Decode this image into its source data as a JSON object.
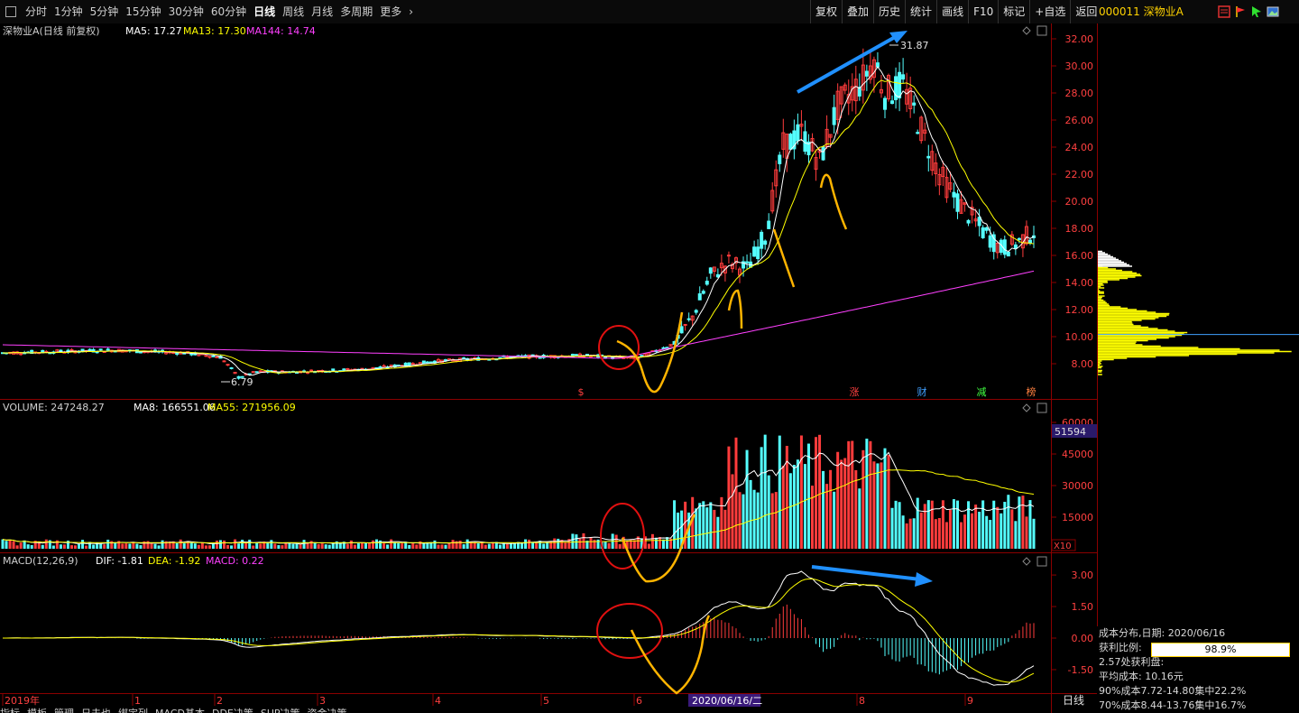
{
  "toolbar": {
    "menu_icon": "window-icon",
    "periods": [
      "分时",
      "1分钟",
      "5分钟",
      "15分钟",
      "30分钟",
      "60分钟",
      "日线",
      "周线",
      "月线",
      "多周期",
      "更多"
    ],
    "active_period": "日线",
    "more_chevron": "›",
    "buttons": [
      "复权",
      "叠加",
      "历史",
      "统计",
      "画线",
      "F10",
      "标记",
      "+自选",
      "返回"
    ],
    "stock_code": "000011",
    "stock_name": "深物业A"
  },
  "main_panel": {
    "title": "深物业A(日线 前复权)",
    "ma5": "MA5: 17.27",
    "ma13": "MA13: 17.30",
    "ma144": "MA144: 14.74",
    "high_label": "31.87",
    "low_label": "6.79",
    "y_ticks": [
      "32.00",
      "30.00",
      "28.00",
      "26.00",
      "24.00",
      "22.00",
      "20.00",
      "18.00",
      "16.00",
      "14.00",
      "12.00",
      "10.00",
      "8.00"
    ],
    "markers": [
      {
        "text": "$",
        "color": "#ff4040"
      },
      {
        "text": "涨",
        "color": "#ff4040"
      },
      {
        "text": "财",
        "color": "#40a0ff"
      },
      {
        "text": "减",
        "color": "#40ff40"
      },
      {
        "text": "榜",
        "color": "#ff8040"
      }
    ]
  },
  "volume_panel": {
    "title": "VOLUME: 247248.27",
    "ma8": "MA8: 166551.06",
    "ma55": "MA55: 271956.09",
    "y_ticks": [
      "60000",
      "45000",
      "30000",
      "15000"
    ],
    "current_box": "51594",
    "unit": "X10"
  },
  "macd_panel": {
    "title": "MACD(12,26,9)",
    "dif": "DIF: -1.81",
    "dea": "DEA: -1.92",
    "macd": "MACD: 0.22",
    "y_ticks": [
      "3.00",
      "1.50",
      "0.00",
      "-1.50"
    ]
  },
  "x_axis": {
    "labels": [
      "2019年",
      "1",
      "2",
      "3",
      "4",
      "5",
      "6",
      "2020/06/16/二",
      "8",
      "9"
    ],
    "period_label": "日线"
  },
  "cost_panel": {
    "title": "成本分布,日期: 2020/06/16",
    "profit_label": "获利比例:",
    "profit_value": "98.9%",
    "profit_ratio": 0.989,
    "line3": "2.57处获利盘:",
    "line4": "平均成本: 10.16元",
    "line5": "90%成本7.72-14.80集中22.2%",
    "line6": "70%成本8.44-13.76集中16.7%"
  },
  "bottom_tabs": [
    "指标",
    "模板",
    "管理",
    "日夫也",
    "绑定列",
    "MACD基本",
    "DDE决策",
    "SUP决策",
    "资金决策"
  ],
  "colors": {
    "up": "#ff3c3c",
    "down": "#54ffff",
    "ma5": "#ffffff",
    "ma13": "#ffff00",
    "ma144": "#ff40ff",
    "annotation_orange": "#ffb400",
    "annotation_blue": "#2090ff",
    "circle_red": "#e01010",
    "cost_yellow": "#ffff00"
  }
}
